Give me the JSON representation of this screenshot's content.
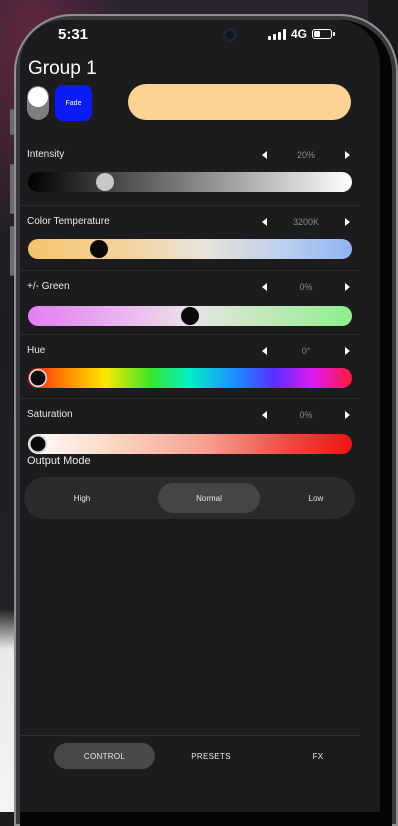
{
  "status": {
    "time": "5:31",
    "network": "4G"
  },
  "group": {
    "title": "Group 1",
    "fade_label": "Fade",
    "preview_color": "#fbd393"
  },
  "sliders": [
    {
      "label": "Intensity",
      "value": "20%",
      "percent": 22
    },
    {
      "label": "Color Temperature",
      "value": "3200K",
      "percent": 20
    },
    {
      "label": "+/- Green",
      "value": "0%",
      "percent": 50
    },
    {
      "label": "Hue",
      "value": "0°",
      "percent": 0
    },
    {
      "label": "Saturation",
      "value": "0%",
      "percent": 0
    }
  ],
  "output_mode": {
    "label": "Output Mode",
    "options": [
      "High",
      "Normal",
      "Low"
    ],
    "selected": "Normal"
  },
  "tabs": [
    {
      "label": "CONTROL",
      "active": true
    },
    {
      "label": "PRESETS",
      "active": false
    },
    {
      "label": "FX",
      "active": false
    }
  ]
}
